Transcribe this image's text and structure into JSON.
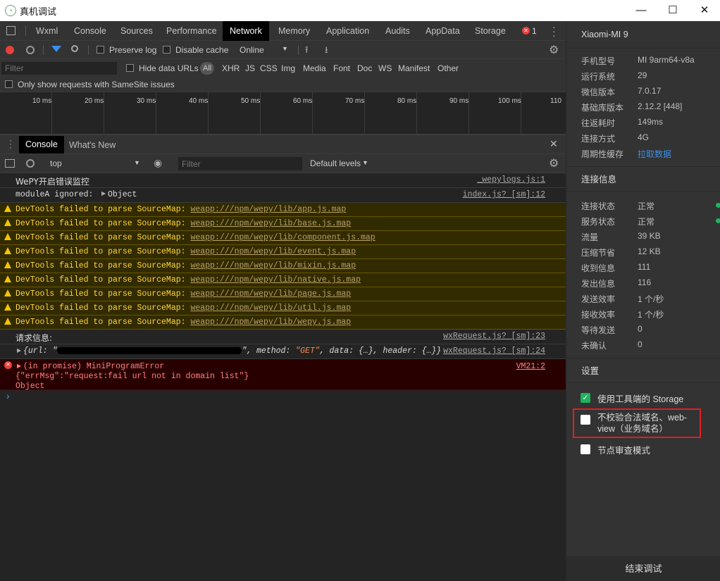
{
  "window": {
    "title": "真机调试",
    "minimize": "—",
    "maximize": "☐",
    "close": "✕"
  },
  "tabs": [
    "Wxml",
    "Console",
    "Sources",
    "Performance",
    "Network",
    "Memory",
    "Application",
    "Audits",
    "AppData",
    "Storage"
  ],
  "active_tab": "Network",
  "error_count": "1",
  "network": {
    "preserve_log": "Preserve log",
    "disable_cache": "Disable cache",
    "throttling": "Online",
    "filter_placeholder": "Filter",
    "hide_data_urls": "Hide data URLs",
    "types": [
      "All",
      "XHR",
      "JS",
      "CSS",
      "Img",
      "Media",
      "Font",
      "Doc",
      "WS",
      "Manifest",
      "Other"
    ],
    "samesite": "Only show requests with SameSite issues",
    "timeline_ticks": [
      "10 ms",
      "20 ms",
      "30 ms",
      "40 ms",
      "50 ms",
      "60 ms",
      "70 ms",
      "80 ms",
      "90 ms",
      "100 ms",
      "110"
    ]
  },
  "drawer": {
    "tabs": [
      "Console",
      "What's New"
    ]
  },
  "console_toolbar": {
    "context": "top",
    "filter_placeholder": "Filter",
    "levels": "Default levels"
  },
  "console": {
    "rows": [
      {
        "type": "info",
        "text": "WePY开启错误监控",
        "source": "_wepylogs.js:1"
      },
      {
        "type": "info",
        "text": "moduleA ignored:",
        "object": "Object",
        "source": "index.js? [sm]:12"
      }
    ],
    "warn_prefix": "DevTools failed to parse SourceMap:",
    "warnings": [
      "weapp:///npm/wepy/lib/app.js.map",
      "weapp:///npm/wepy/lib/base.js.map",
      "weapp:///npm/wepy/lib/component.js.map",
      "weapp:///npm/wepy/lib/event.js.map",
      "weapp:///npm/wepy/lib/mixin.js.map",
      "weapp:///npm/wepy/lib/native.js.map",
      "weapp:///npm/wepy/lib/page.js.map",
      "weapp:///npm/wepy/lib/util.js.map",
      "weapp:///npm/wepy/lib/wepy.js.map"
    ],
    "request_label": "请求信息:",
    "request_source": "wxRequest.js? [sm]:23",
    "request_obj_a": "{url: \"",
    "request_obj_b": "\", method: ",
    "request_method": "\"GET\"",
    "request_obj_c": ", data: {…}, header: {…}}",
    "request_obj_source": "wxRequest.js? [sm]:24",
    "error_title": "(in promise) MiniProgramError",
    "error_source": "VM21:2",
    "error_line2": "{\"errMsg\":\"request:fail url not in domain list\"}",
    "error_line3": "Object",
    "prompt": "›"
  },
  "device": {
    "name": "Xiaomi-MI 9",
    "info": [
      {
        "k": "手机型号",
        "v": "MI 9arm64-v8a"
      },
      {
        "k": "运行系统",
        "v": "29"
      },
      {
        "k": "微信版本",
        "v": "7.0.17"
      },
      {
        "k": "基础库版本",
        "v": "2.12.2 [448]"
      },
      {
        "k": "往返耗时",
        "v": "149ms"
      },
      {
        "k": "连接方式",
        "v": "4G"
      },
      {
        "k": "周期性缓存",
        "v": "拉取数据"
      }
    ],
    "conn_header": "连接信息",
    "conn": [
      {
        "k": "连接状态",
        "v": "正常",
        "dot": true
      },
      {
        "k": "服务状态",
        "v": "正常",
        "dot": true
      },
      {
        "k": "流量",
        "v": "39 KB"
      },
      {
        "k": "压缩节省",
        "v": "12 KB"
      },
      {
        "k": "收到信息",
        "v": "111"
      },
      {
        "k": "发出信息",
        "v": "116"
      },
      {
        "k": "发送效率",
        "v": "1 个/秒"
      },
      {
        "k": "接收效率",
        "v": "1 个/秒"
      },
      {
        "k": "等待发送",
        "v": "0"
      },
      {
        "k": "未确认",
        "v": "0"
      }
    ],
    "settings_header": "设置",
    "settings": [
      {
        "label": "使用工具端的 Storage",
        "checked": true
      },
      {
        "label": "不校验合法域名、web-view（业务域名）",
        "checked": false,
        "highlighted": true
      },
      {
        "label": "节点审查模式",
        "checked": false
      }
    ],
    "end_button": "结束调试"
  },
  "colors": {
    "accent_blue": "#3b8eea",
    "record_red": "#e8413b",
    "green": "#1db45d",
    "highlight_red": "#e02020"
  }
}
